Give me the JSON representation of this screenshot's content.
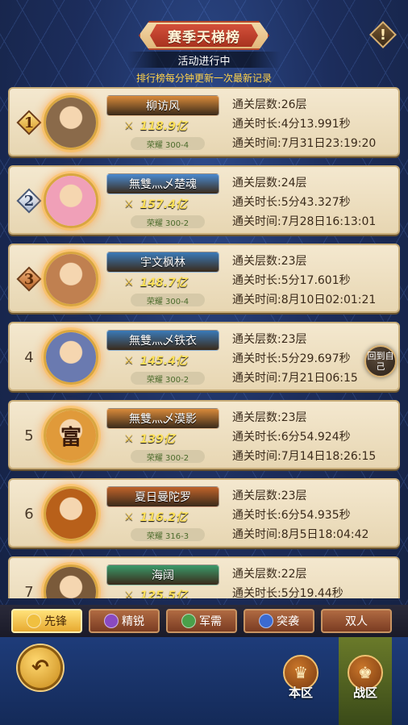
{
  "header": {
    "title": "赛季天梯榜",
    "status": "活动进行中",
    "notice": "排行榜每分钟更新一次最新记录",
    "help_glyph": "!"
  },
  "labels": {
    "layers": "通关层数:",
    "duration": "通关时长:",
    "time": "通关时间:"
  },
  "rows": [
    {
      "rank": "1",
      "medal": "gold",
      "name": "柳访风",
      "power": "118.9亿",
      "honor": "荣耀  300-4",
      "layers": "26层",
      "duration": "4分13.991秒",
      "time": "7月31日23:19:20",
      "plate_color": "#d98a3a",
      "avatar_color": "#8a6a4a"
    },
    {
      "rank": "2",
      "medal": "silver",
      "name": "無雙灬乄楚魂",
      "power": "157.4亿",
      "honor": "荣耀  300-2",
      "layers": "24层",
      "duration": "5分43.327秒",
      "time": "7月28日16:13:01",
      "plate_color": "#4a8ad0",
      "avatar_color": "#f0a0b8"
    },
    {
      "rank": "3",
      "medal": "bronze",
      "name": "宇文枫林",
      "power": "148.7亿",
      "honor": "荣耀  300-4",
      "layers": "23层",
      "duration": "5分17.601秒",
      "time": "8月10日02:01:21",
      "plate_color": "#3a7ab8",
      "avatar_color": "#c08050"
    },
    {
      "rank": "4",
      "medal": "plain",
      "name": "無雙灬乄铁衣",
      "power": "145.4亿",
      "honor": "荣耀  300-2",
      "layers": "23层",
      "duration": "5分29.697秒",
      "time": "7月21日06:15",
      "plate_color": "#3a7ab8",
      "avatar_color": "#6a7ab0"
    },
    {
      "rank": "5",
      "medal": "plain",
      "name": "無雙灬乄漠影",
      "power": "139亿",
      "honor": "荣耀  300-2",
      "layers": "23层",
      "duration": "6分54.924秒",
      "time": "7月14日18:26:15",
      "plate_color": "#d98a3a",
      "avatar_color": "#e09a3a",
      "avatar_glyph": "富"
    },
    {
      "rank": "6",
      "medal": "plain",
      "name": "夏日曼陀罗",
      "power": "116.2亿",
      "honor": "荣耀  316-3",
      "layers": "23层",
      "duration": "6分54.935秒",
      "time": "8月5日18:04:42",
      "plate_color": "#c0632a",
      "avatar_color": "#b8601a"
    },
    {
      "rank": "7",
      "medal": "plain",
      "name": "海阔",
      "power": "125.5亿",
      "honor": "",
      "layers": "22层",
      "duration": "5分19.44秒",
      "time": "",
      "plate_color": "#3a9a6a",
      "avatar_color": "#7a5a3a"
    }
  ],
  "self_button": "回到自己",
  "tabs": [
    {
      "label": "先锋",
      "active": true,
      "icon_color": "#f0c040"
    },
    {
      "label": "精锐",
      "active": false,
      "icon_color": "#8a4ac0"
    },
    {
      "label": "军需",
      "active": false,
      "icon_color": "#4aa04a"
    },
    {
      "label": "突袭",
      "active": false,
      "icon_color": "#3a6ad0"
    },
    {
      "label": "双人",
      "active": false,
      "icon_color": ""
    }
  ],
  "bottom": {
    "back_glyph": "↶",
    "local_zone": "本区",
    "battle_zone": "战区"
  }
}
